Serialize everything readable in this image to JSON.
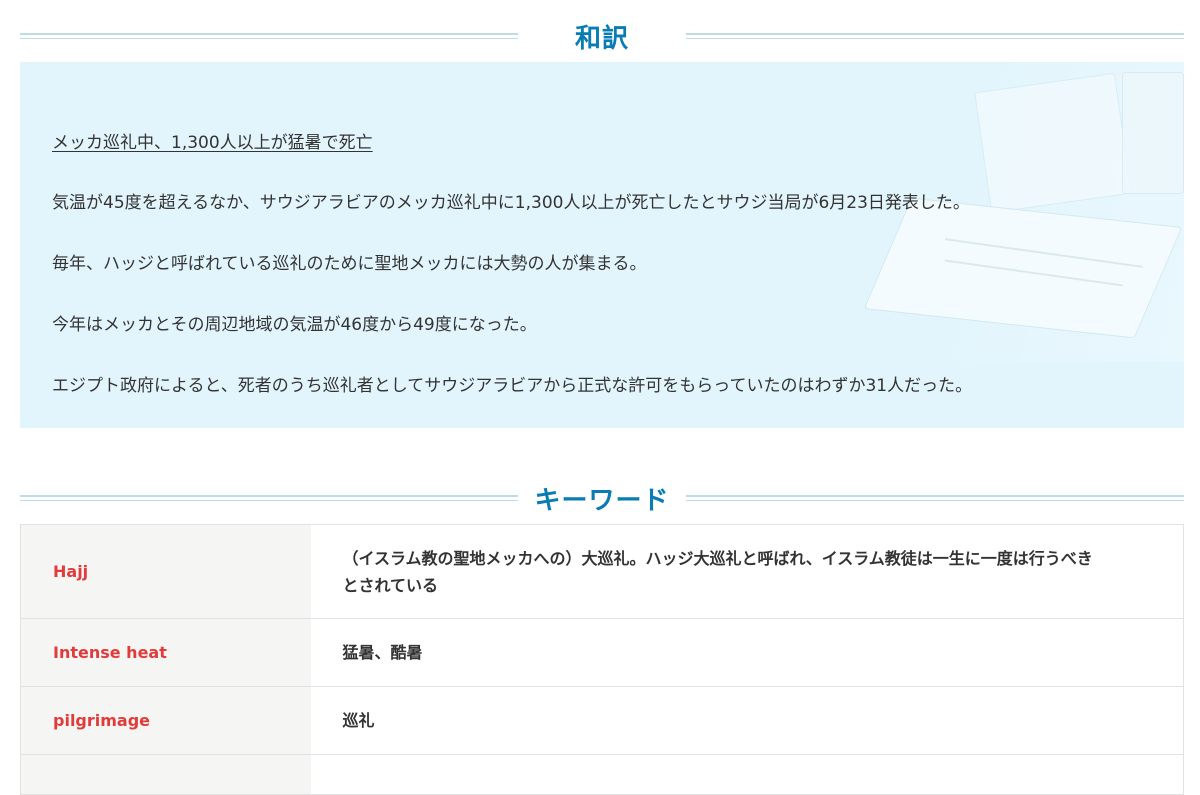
{
  "headings": {
    "translation": "和訳",
    "keywords": "キーワード"
  },
  "translation": {
    "headline": "メッカ巡礼中、1,300人以上が猛暑で死亡",
    "paragraphs": [
      "気温が45度を超えるなか、サウジアラビアのメッカ巡礼中に1,300人以上が死亡したとサウジ当局が6月23日発表した。",
      "毎年、ハッジと呼ばれている巡礼のために聖地メッカには大勢の人が集まる。",
      "今年はメッカとその周辺地域の気温が46度から49度になった。",
      "エジプト政府によると、死者のうち巡礼者としてサウジアラビアから正式な許可をもらっていたのはわずか31人だった。"
    ]
  },
  "keywords": [
    {
      "term": "Hajj",
      "definition_line1": "（イスラム教の聖地メッカへの）大巡礼。ハッジ大巡礼と呼ばれ、イスラム教徒は一生に一度は行うべき",
      "definition_line2": "とされている"
    },
    {
      "term": "Intense heat",
      "definition_line1": "猛暑、酷暑",
      "definition_line2": ""
    },
    {
      "term": "pilgrimage",
      "definition_line1": "巡礼",
      "definition_line2": ""
    }
  ],
  "colors": {
    "heading_text": "#0a7cb4",
    "heading_rule": "#bcdce9",
    "translation_bg": "#e2f5fc",
    "keyword_term": "#e23b3b",
    "keyword_term_bg": "#f5f5f3"
  }
}
